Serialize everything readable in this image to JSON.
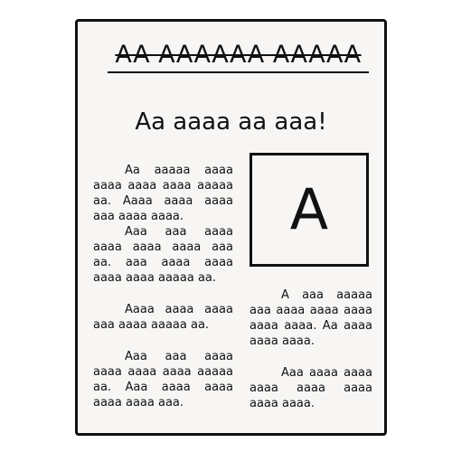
{
  "masthead": "AA AAAAAA AAAAA",
  "headline": "Aa aaaa aa aaa!",
  "photo_letter": "A",
  "left_column": [
    "Aa aaaaa aaaa aaaa aaaa aaaa aaaaa aa. Aaaa aaaa aaaa aaa aaaa aaaa.",
    "Aaa aaa aaaa aaaa aaaa aaaa aaa aa. aaa aaaa aaaa aaaa aaaa aaaaa aa.",
    "Aaaa aaaa aaaa aaa aaaa aaaaa aa.",
    "Aaa aaa aaaa aaaa aaaa aaaa aaaaa aa. Aaa aaaa aaaa aaaa aaaa aaa."
  ],
  "right_column": [
    "A aaa aaaaa aaa aaaa aaaa aaaa aaaa aaaa. Aa aaaa aaaa aaaa.",
    "Aaa aaaa aaaa aaaa aaaa aaaa aaaa aaaa."
  ]
}
